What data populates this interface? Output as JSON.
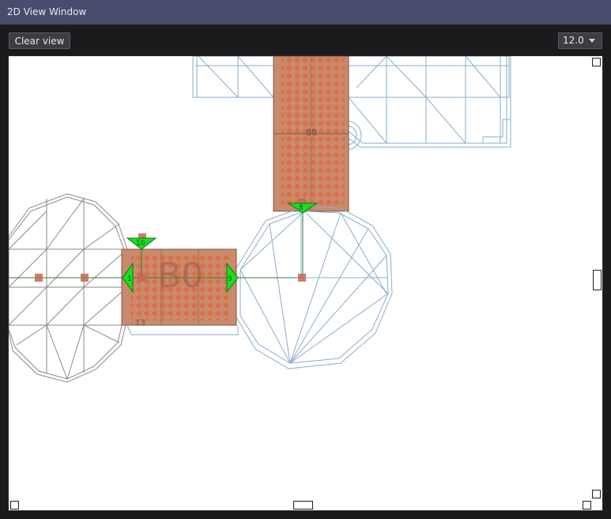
{
  "window": {
    "title": "2D View Window"
  },
  "toolbar": {
    "clear_label": "Clear view",
    "zoom_value": "12.0"
  },
  "canvas": {
    "room_label": "B0",
    "room_numbers": {
      "top_room": "88",
      "small_room": "13"
    },
    "markers": {
      "top": "8",
      "left_top": "10",
      "left_side": "1",
      "right_side": "9"
    },
    "colors": {
      "room_fill": "#c98a6e",
      "room_dots": "#e0663a",
      "mesh_blue": "#8aaccc",
      "mesh_gray": "#8a8a8a",
      "marker_green": "#1fdc1f"
    }
  }
}
